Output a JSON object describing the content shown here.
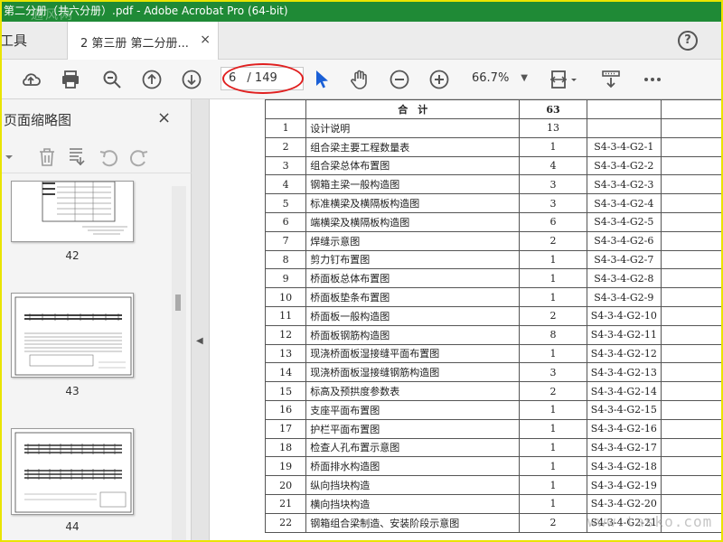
{
  "titlebar": {
    "title": "第二分册（共六分册）.pdf - Adobe Acrobat Pro (64-bit)"
  },
  "tabs": {
    "tools": "工具",
    "document": "2 第三册 第二分册...",
    "close": "×"
  },
  "toolbar": {
    "page_current": "6",
    "page_total": "/ 149",
    "zoom": "66.7%",
    "icons": [
      "cloud-upload-icon",
      "print-icon",
      "search-zoom-icon",
      "page-up-icon",
      "page-down-icon",
      "select-cursor-icon",
      "hand-tool-icon",
      "zoom-out-icon",
      "zoom-in-icon",
      "page-fit-icon",
      "scroll-mode-icon",
      "more-icon"
    ]
  },
  "leftpane": {
    "title": "页面缩略图",
    "close": "×",
    "thumbnails": [
      {
        "label": "42"
      },
      {
        "label": "43"
      },
      {
        "label": "44"
      }
    ]
  },
  "table": {
    "header": {
      "label": "合　计",
      "count": "63"
    },
    "rows": [
      {
        "no": "1",
        "name": "设计说明",
        "count": "13",
        "code": ""
      },
      {
        "no": "2",
        "name": "组合梁主要工程数量表",
        "count": "1",
        "code": "S4-3-4-G2-1"
      },
      {
        "no": "3",
        "name": "组合梁总体布置图",
        "count": "4",
        "code": "S4-3-4-G2-2"
      },
      {
        "no": "4",
        "name": "钢箱主梁一般构造图",
        "count": "3",
        "code": "S4-3-4-G2-3"
      },
      {
        "no": "5",
        "name": "标准横梁及横隔板构造图",
        "count": "3",
        "code": "S4-3-4-G2-4"
      },
      {
        "no": "6",
        "name": "端横梁及横隔板构造图",
        "count": "6",
        "code": "S4-3-4-G2-5"
      },
      {
        "no": "7",
        "name": "焊缝示意图",
        "count": "2",
        "code": "S4-3-4-G2-6"
      },
      {
        "no": "8",
        "name": "剪力钉布置图",
        "count": "1",
        "code": "S4-3-4-G2-7"
      },
      {
        "no": "9",
        "name": "桥面板总体布置图",
        "count": "1",
        "code": "S4-3-4-G2-8"
      },
      {
        "no": "10",
        "name": "桥面板垫条布置图",
        "count": "1",
        "code": "S4-3-4-G2-9"
      },
      {
        "no": "11",
        "name": "桥面板一般构造图",
        "count": "2",
        "code": "S4-3-4-G2-10"
      },
      {
        "no": "12",
        "name": "桥面板钢筋构造图",
        "count": "8",
        "code": "S4-3-4-G2-11"
      },
      {
        "no": "13",
        "name": "现浇桥面板湿接缝平面布置图",
        "count": "1",
        "code": "S4-3-4-G2-12"
      },
      {
        "no": "14",
        "name": "现浇桥面板湿接缝钢筋构造图",
        "count": "3",
        "code": "S4-3-4-G2-13"
      },
      {
        "no": "15",
        "name": "标高及预拱度参数表",
        "count": "2",
        "code": "S4-3-4-G2-14"
      },
      {
        "no": "16",
        "name": "支座平面布置图",
        "count": "1",
        "code": "S4-3-4-G2-15"
      },
      {
        "no": "17",
        "name": "护栏平面布置图",
        "count": "1",
        "code": "S4-3-4-G2-16"
      },
      {
        "no": "18",
        "name": "检查人孔布置示意图",
        "count": "1",
        "code": "S4-3-4-G2-17"
      },
      {
        "no": "19",
        "name": "桥面排水构造图",
        "count": "1",
        "code": "S4-3-4-G2-18"
      },
      {
        "no": "20",
        "name": "纵向挡块构造",
        "count": "1",
        "code": "S4-3-4-G2-19"
      },
      {
        "no": "21",
        "name": "横向挡块构造",
        "count": "1",
        "code": "S4-3-4-G2-20"
      },
      {
        "no": "22",
        "name": "钢箱组合梁制造、安装阶段示意图",
        "count": "2",
        "code": "S4-3-4-G2-21"
      }
    ]
  },
  "watermarks": {
    "top": "通风网",
    "bottom_right": "www.tasko.com"
  },
  "colors": {
    "titlebar": "#1f8a36",
    "frame": "#e9e400",
    "highlight_ellipse": "#e02020",
    "cursor_blue": "#1a5fd6"
  }
}
